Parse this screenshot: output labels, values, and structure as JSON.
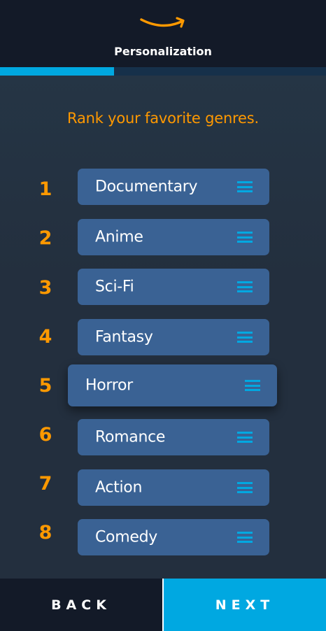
{
  "header": {
    "title": "Personalization",
    "logo_icon": "amazon-smile-icon"
  },
  "progress": {
    "fraction": 0.35
  },
  "prompt": "Rank your favorite genres.",
  "genres": [
    {
      "rank": "1",
      "label": "Documentary"
    },
    {
      "rank": "2",
      "label": "Anime"
    },
    {
      "rank": "3",
      "label": "Sci-Fi"
    },
    {
      "rank": "4",
      "label": "Fantasy"
    },
    {
      "rank": "5",
      "label": "Horror",
      "dragging": true
    },
    {
      "rank": "6",
      "label": "Romance"
    },
    {
      "rank": "7",
      "label": "Action"
    },
    {
      "rank": "8",
      "label": "Comedy"
    }
  ],
  "footer": {
    "back_label": "BACK",
    "next_label": "NEXT"
  },
  "colors": {
    "accent_orange": "#ff9900",
    "accent_blue": "#00a8e1",
    "chip": "#3a6294",
    "header": "#131a28",
    "background": "#232f3e"
  }
}
